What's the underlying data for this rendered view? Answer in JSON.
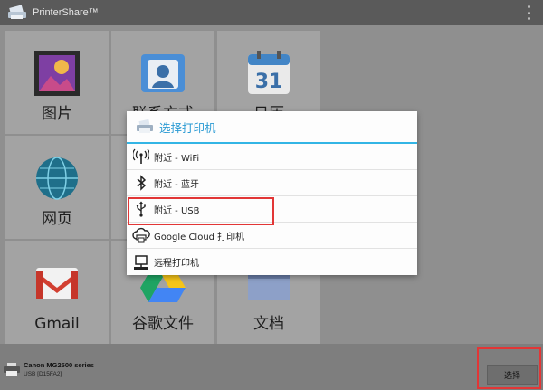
{
  "app": {
    "title": "PrinterShare™"
  },
  "tiles": [
    {
      "id": "photos",
      "label": "图片"
    },
    {
      "id": "contacts",
      "label": "联系方式"
    },
    {
      "id": "calendar",
      "label": "日历",
      "day": "31"
    },
    {
      "id": "web",
      "label": "网页"
    },
    {
      "id": "gmail",
      "label": "Gmail"
    },
    {
      "id": "drive",
      "label": "谷歌文件"
    },
    {
      "id": "docs",
      "label": "文档"
    }
  ],
  "dialog": {
    "title": "选择打印机",
    "options": [
      {
        "id": "wifi",
        "label": "附近 - WiFi",
        "icon": "wifi-antenna-icon"
      },
      {
        "id": "bluetooth",
        "label": "附近 - 蓝牙",
        "icon": "bluetooth-icon"
      },
      {
        "id": "usb",
        "label": "附近 - USB",
        "icon": "usb-icon"
      },
      {
        "id": "cloud",
        "label": "Google Cloud 打印机",
        "icon": "cloud-printer-icon"
      },
      {
        "id": "remote",
        "label": "远程打印机",
        "icon": "remote-computer-icon"
      }
    ]
  },
  "status": {
    "printer_name": "Canon MG2500 series",
    "printer_sub": "USB [D15FA2]",
    "select_label": "选择"
  },
  "colors": {
    "accent": "#33b5e5",
    "highlight": "#e23636"
  }
}
